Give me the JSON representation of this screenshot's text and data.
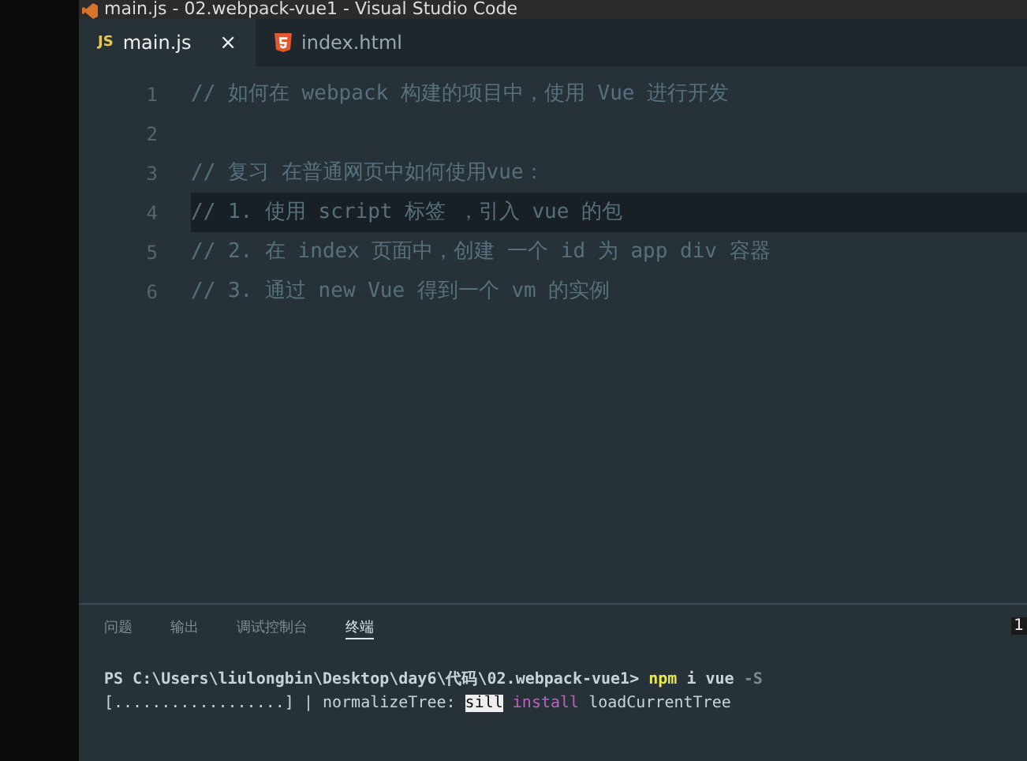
{
  "window": {
    "title": "main.js - 02.webpack-vue1 - Visual Studio Code"
  },
  "tabs": [
    {
      "label": "main.js",
      "kind": "js",
      "icon": "JS",
      "selected": true,
      "close": "×"
    },
    {
      "label": "index.html",
      "kind": "html",
      "selected": false
    }
  ],
  "editor": {
    "lines": [
      {
        "number": "1",
        "text": "// 如何在 webpack 构建的项目中，使用 Vue 进行开发",
        "current": false
      },
      {
        "number": "2",
        "current": false
      },
      {
        "number": "3",
        "text": "// 复习 在普通网页中如何使用vue：",
        "current": false
      },
      {
        "number": "4",
        "text": "// 1. 使用 script 标签 ，引入 vue 的包",
        "current": true
      },
      {
        "number": "5",
        "text": "// 2. 在 index 页面中，创建 一个 id 为 app div 容器",
        "current": false
      },
      {
        "number": "6",
        "text": "// 3. 通过 new Vue 得到一个 vm 的实例",
        "current": false
      }
    ]
  },
  "panel": {
    "tabs": [
      {
        "label": "问题",
        "selected": false
      },
      {
        "label": "输出",
        "selected": false
      },
      {
        "label": "调试控制台",
        "selected": false
      },
      {
        "label": "终端",
        "selected": true
      }
    ],
    "badge": "1",
    "terminal": [
      [
        {
          "kind": "plain",
          "text": "PS C:\\Users\\liulongbin\\Desktop\\day6\\代码\\02.webpack-vue1> "
        },
        {
          "kind": "command",
          "text": "npm"
        },
        {
          "kind": "plain",
          "text": " i vue "
        },
        {
          "kind": "flag",
          "text": "-S"
        }
      ],
      [
        {
          "kind": "dim",
          "text": "[..................]"
        },
        {
          "kind": "plain",
          "text": " | normalizeTree: "
        },
        {
          "kind": "highlight",
          "text": "sill"
        },
        {
          "kind": "keyword",
          "text": " install"
        },
        {
          "kind": "plain",
          "text": " loadCurrentTree"
        }
      ]
    ]
  }
}
